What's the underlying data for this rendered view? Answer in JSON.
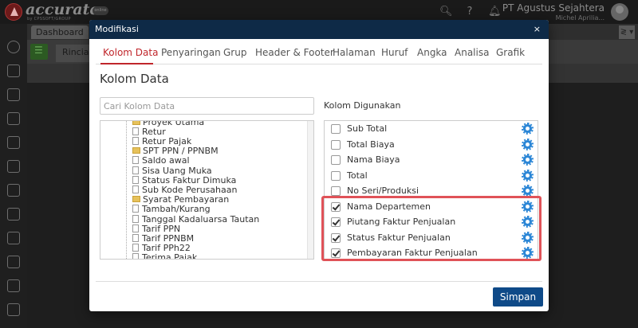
{
  "app": {
    "logo_text": "accurate",
    "logo_subtitle": "by CPSSOFT/GROUP",
    "logo_badge": "online",
    "company_name": "PT Agustus Sejahtera",
    "user_name": "Michel Aprilia...",
    "background_tab": "Dashboard",
    "background_tab_right": "≷ ▾",
    "workspace_tab": "Rincia"
  },
  "modal": {
    "title": "Modifikasi",
    "close_label": "×",
    "tabs": [
      {
        "label": "Kolom Data",
        "active": true
      },
      {
        "label": "Penyaringan",
        "active": false
      },
      {
        "label": "Grup",
        "active": false
      },
      {
        "label": "Header & Footer",
        "active": false
      },
      {
        "label": "Halaman",
        "active": false
      },
      {
        "label": "Huruf",
        "active": false
      },
      {
        "label": "Angka",
        "active": false
      },
      {
        "label": "Analisa",
        "active": false
      },
      {
        "label": "Grafik",
        "active": false
      }
    ],
    "section_title": "Kolom Data",
    "search_placeholder": "Cari Kolom Data",
    "tree_items": [
      {
        "label": "Proyek Utama",
        "type": "folder"
      },
      {
        "label": "Retur",
        "type": "file"
      },
      {
        "label": "Retur Pajak",
        "type": "file"
      },
      {
        "label": "SPT PPN / PPNBM",
        "type": "folder"
      },
      {
        "label": "Saldo awal",
        "type": "file"
      },
      {
        "label": "Sisa Uang Muka",
        "type": "file"
      },
      {
        "label": "Status Faktur Dimuka",
        "type": "file"
      },
      {
        "label": "Sub Kode Perusahaan",
        "type": "file"
      },
      {
        "label": "Syarat Pembayaran",
        "type": "folder"
      },
      {
        "label": "Tambah/Kurang",
        "type": "file"
      },
      {
        "label": "Tanggal Kadaluarsa Tautan",
        "type": "file"
      },
      {
        "label": "Tarif PPN",
        "type": "file"
      },
      {
        "label": "Tarif PPNBM",
        "type": "file"
      },
      {
        "label": "Tarif PPh22",
        "type": "file"
      },
      {
        "label": "Terima Pajak",
        "type": "file"
      }
    ],
    "used_title": "Kolom Digunakan",
    "used_columns": [
      {
        "label": "Sub Total",
        "checked": false
      },
      {
        "label": "Total Biaya",
        "checked": false
      },
      {
        "label": "Nama Biaya",
        "checked": false
      },
      {
        "label": "Total",
        "checked": false
      },
      {
        "label": "No Seri/Produksi",
        "checked": false
      },
      {
        "label": "Nama Departemen",
        "checked": true
      },
      {
        "label": "Piutang Faktur Penjualan",
        "checked": true
      },
      {
        "label": "Status Faktur Penjualan",
        "checked": true
      },
      {
        "label": "Pembayaran Faktur Penjualan",
        "checked": true
      }
    ],
    "save_label": "Simpan"
  },
  "colors": {
    "modal_header": "#0e2a47",
    "accent_tab": "#c0262b",
    "save_button": "#0f4a88",
    "highlight_box": "#e05258",
    "gear_icon": "#2b86d6"
  }
}
